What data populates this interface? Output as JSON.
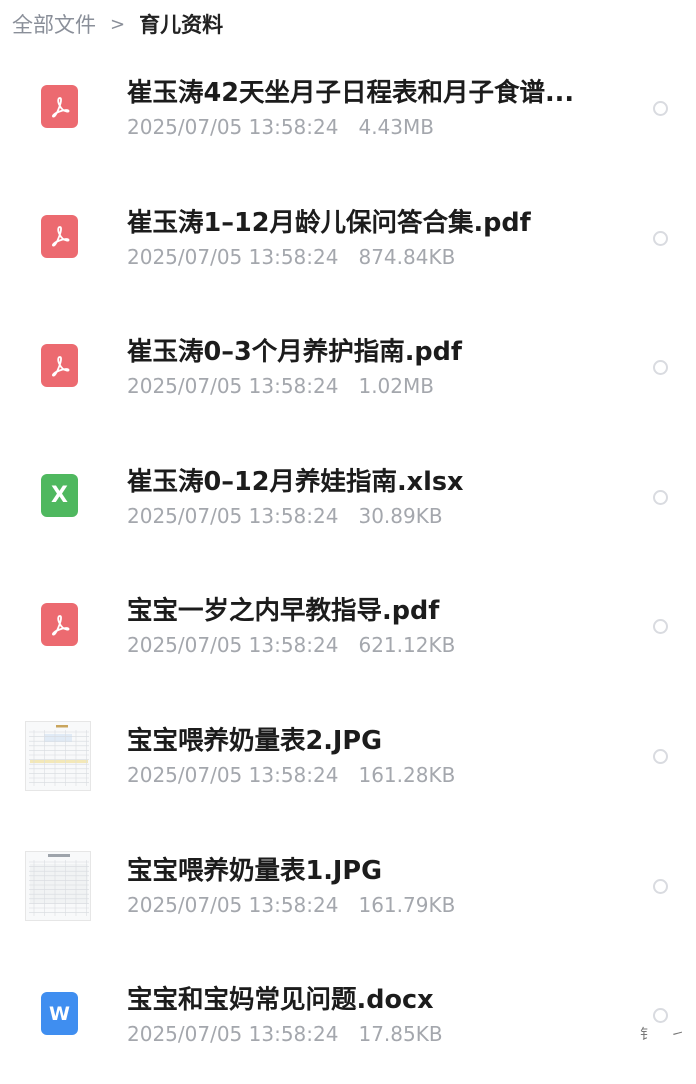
{
  "breadcrumb": {
    "root": "全部文件",
    "separator": ">",
    "current": "育儿资料"
  },
  "files": [
    {
      "name": "崔玉涛42天坐月子日程表和月子食谱...",
      "date": "2025/07/05 13:58:24",
      "size": "4.43MB",
      "type": "pdf",
      "icon": "pdf-icon"
    },
    {
      "name": "崔玉涛1–12月龄儿保问答合集.pdf",
      "date": "2025/07/05 13:58:24",
      "size": "874.84KB",
      "type": "pdf",
      "icon": "pdf-icon"
    },
    {
      "name": "崔玉涛0–3个月养护指南.pdf",
      "date": "2025/07/05 13:58:24",
      "size": "1.02MB",
      "type": "pdf",
      "icon": "pdf-icon"
    },
    {
      "name": "崔玉涛0–12月养娃指南.xlsx",
      "date": "2025/07/05 13:58:24",
      "size": "30.89KB",
      "type": "xlsx",
      "icon": "excel-icon"
    },
    {
      "name": "宝宝一岁之内早教指导.pdf",
      "date": "2025/07/05 13:58:24",
      "size": "621.12KB",
      "type": "pdf",
      "icon": "pdf-icon"
    },
    {
      "name": "宝宝喂养奶量表2.JPG",
      "date": "2025/07/05 13:58:24",
      "size": "161.28KB",
      "type": "jpg",
      "icon": "image-thumbnail"
    },
    {
      "name": "宝宝喂养奶量表1.JPG",
      "date": "2025/07/05 13:58:24",
      "size": "161.79KB",
      "type": "jpg",
      "icon": "image-thumbnail"
    },
    {
      "name": "宝宝和宝妈常见问题.docx",
      "date": "2025/07/05 13:58:24",
      "size": "17.85KB",
      "type": "docx",
      "icon": "word-icon"
    }
  ],
  "icon_glyphs": {
    "xlsx": "X",
    "docx": "W"
  },
  "colors": {
    "pdf": "#ec6a70",
    "xlsx": "#4fb85f",
    "docx": "#3f8ef0"
  },
  "watermark": "钅 ㇀"
}
